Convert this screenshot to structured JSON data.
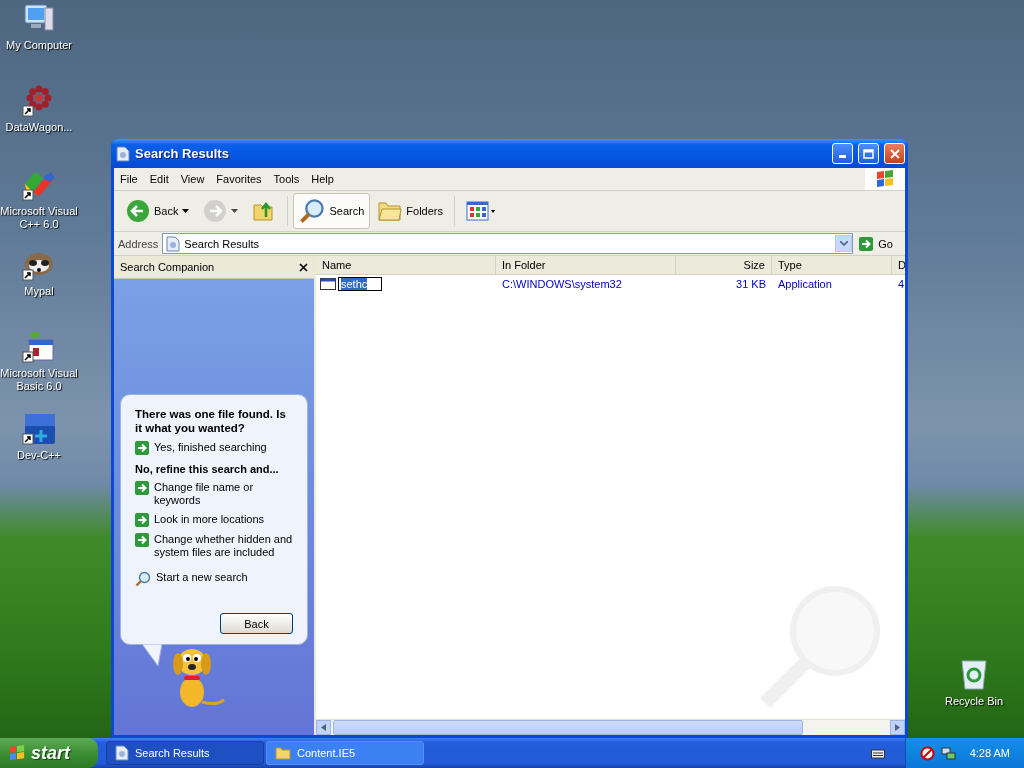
{
  "desktop_icons": [
    {
      "label": "My Computer",
      "kind": "computer",
      "shortcut": false
    },
    {
      "label": "DataWagon...",
      "kind": "flower",
      "shortcut": true
    },
    {
      "label": "Microsoft Visual C++ 6.0",
      "kind": "vcpp",
      "shortcut": true
    },
    {
      "label": "Mypal",
      "kind": "animal",
      "shortcut": true
    },
    {
      "label": "Microsoft Visual Basic 6.0",
      "kind": "vb",
      "shortcut": true
    },
    {
      "label": "Dev-C++",
      "kind": "dev",
      "shortcut": true
    }
  ],
  "recycle_bin": {
    "label": "Recycle Bin"
  },
  "window": {
    "title": "Search Results",
    "menu": [
      "File",
      "Edit",
      "View",
      "Favorites",
      "Tools",
      "Help"
    ],
    "toolbar": [
      {
        "kind": "back",
        "label": "Back",
        "pressed": false,
        "disabled": false
      },
      {
        "kind": "forward",
        "pressed": false,
        "disabled": true
      },
      {
        "kind": "up",
        "pressed": false,
        "disabled": false
      },
      {
        "kind": "search",
        "label": "Search",
        "pressed": true,
        "disabled": false
      },
      {
        "kind": "folders",
        "label": "Folders",
        "pressed": false,
        "disabled": false
      },
      {
        "kind": "views",
        "pressed": false,
        "disabled": false
      }
    ],
    "address": {
      "label": "Address",
      "value": "Search Results",
      "go": "Go"
    },
    "companion": {
      "title": "Search Companion",
      "question": "There was one file found. Is it what you wanted?",
      "items": [
        {
          "kind": "link",
          "label": "Yes, finished searching"
        },
        {
          "kind": "heading",
          "label": "No, refine this search and..."
        },
        {
          "kind": "link",
          "label": "Change file name or keywords"
        },
        {
          "kind": "link",
          "label": "Look in more locations"
        },
        {
          "kind": "link",
          "label": "Change whether hidden and system files are included"
        },
        {
          "kind": "search",
          "label": "Start a new search"
        }
      ],
      "button": "Back"
    },
    "table": {
      "columns": [
        "Name",
        "In Folder",
        "Size",
        "Type",
        "D"
      ],
      "rows": [
        {
          "cells": [
            "sethc",
            "C:\\WINDOWS\\system32",
            "31 KB",
            "Application",
            "4"
          ],
          "selected": true
        }
      ]
    }
  },
  "taskbar": {
    "start": "start",
    "tasks": [
      {
        "label": "Search Results",
        "kind": "page",
        "selected": true
      },
      {
        "label": "Content.IE5",
        "kind": "folder",
        "selected": false
      }
    ],
    "clock": "4:28 AM"
  }
}
